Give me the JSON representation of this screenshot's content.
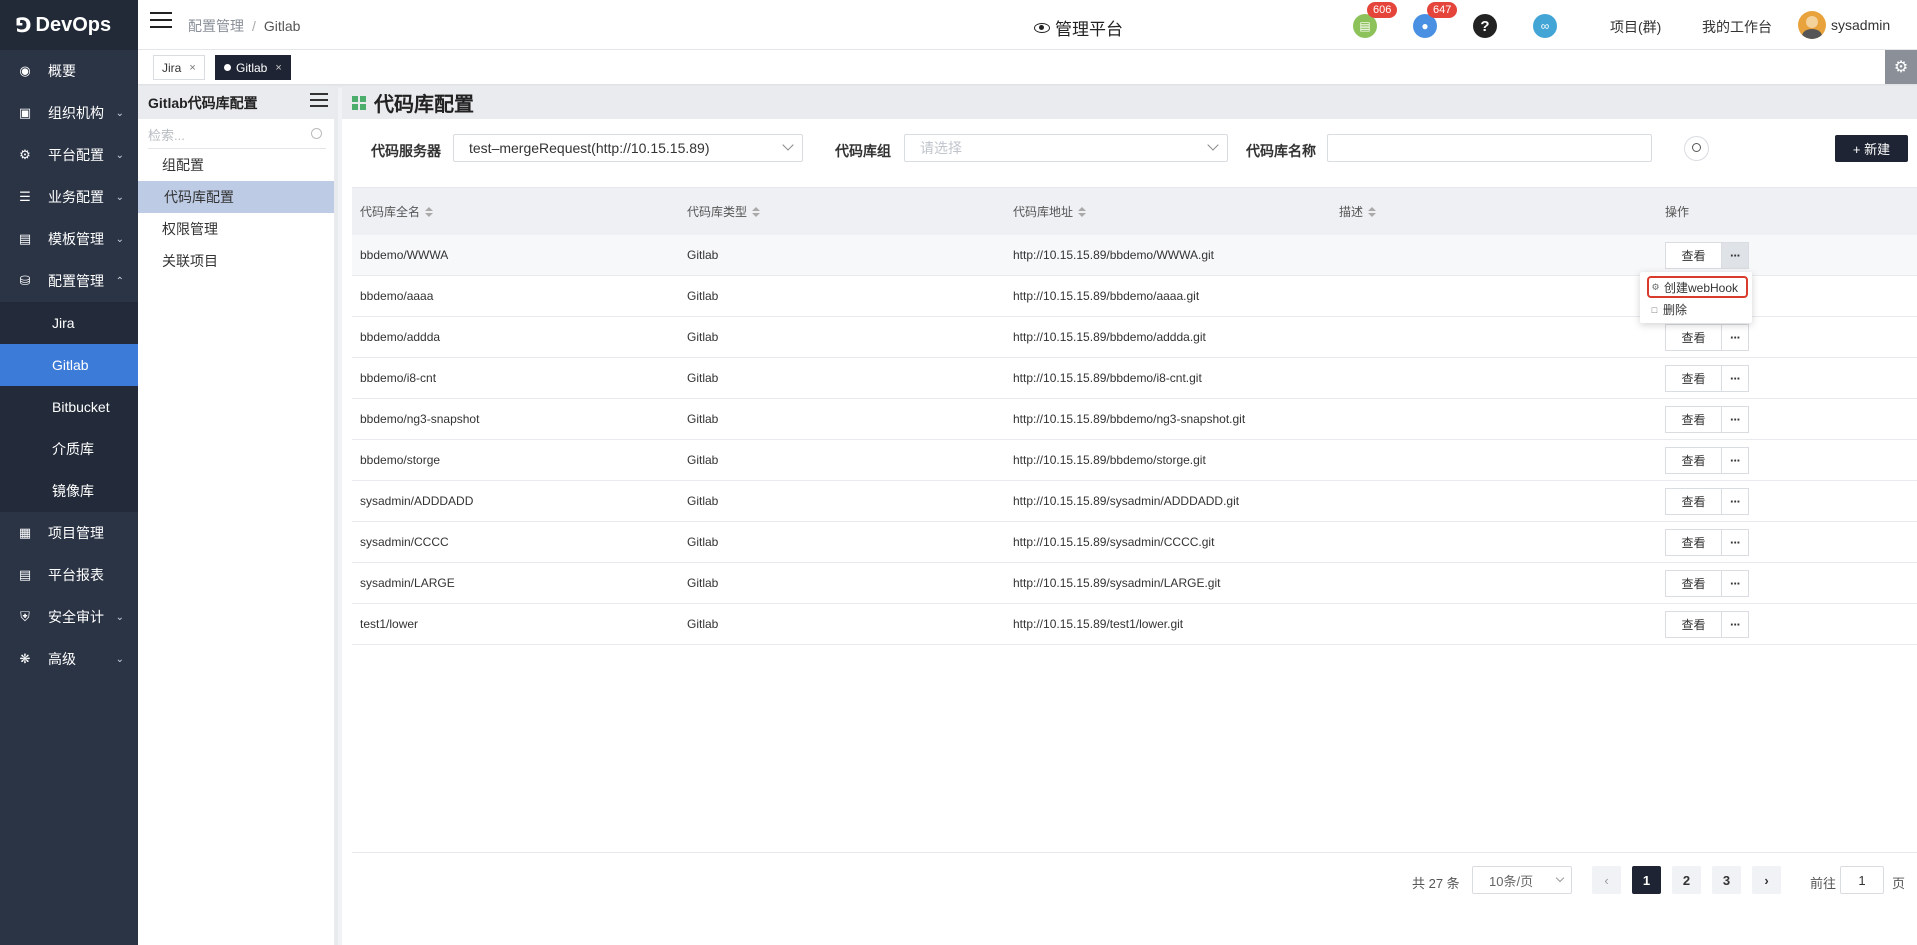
{
  "app": {
    "logo": "DevOps"
  },
  "nav": [
    {
      "label": "概要",
      "icon": "dashboard-icon"
    },
    {
      "label": "组织机构",
      "icon": "lock-icon"
    },
    {
      "label": "平台配置",
      "icon": "gear-icon"
    },
    {
      "label": "业务配置",
      "icon": "sliders-icon"
    },
    {
      "label": "模板管理",
      "icon": "template-icon"
    },
    {
      "label": "配置管理",
      "icon": "database-icon"
    },
    {
      "label": "Jira"
    },
    {
      "label": "Gitlab"
    },
    {
      "label": "Bitbucket"
    },
    {
      "label": "介质库"
    },
    {
      "label": "镜像库"
    },
    {
      "label": "项目管理",
      "icon": "grid-icon"
    },
    {
      "label": "平台报表",
      "icon": "monitor-icon"
    },
    {
      "label": "安全审计",
      "icon": "shield-icon"
    },
    {
      "label": "高级",
      "icon": "advanced-gear-icon"
    }
  ],
  "header": {
    "breadcrumb": [
      "配置管理",
      "/",
      "Gitlab"
    ],
    "title": "管理平台",
    "doc_badge": "606",
    "bell_badge": "647",
    "links": [
      "项目(群)",
      "我的工作台"
    ],
    "user": "sysadmin",
    "colors": {
      "doc": "#8dc25a",
      "bell": "#4a90e2",
      "help": "#222222",
      "link": "#43a5d5"
    }
  },
  "tabs": [
    {
      "label": "Jira"
    },
    {
      "label": "Gitlab"
    }
  ],
  "subside": {
    "title": "Gitlab代码库配置",
    "search_placeholder": "检索...",
    "items": [
      "组配置",
      "代码库配置",
      "权限管理",
      "关联项目"
    ]
  },
  "page": {
    "title": "代码库配置",
    "filters": {
      "server_label": "代码服务器",
      "server_value": "test–mergeRequest(http://10.15.15.89)",
      "group_label": "代码库组",
      "group_placeholder": "请选择",
      "name_label": "代码库名称"
    },
    "new_button": "+ 新建"
  },
  "table": {
    "headers": [
      "代码库全名",
      "代码库类型",
      "代码库地址",
      "描述",
      "操作"
    ],
    "view_label": "查看",
    "more_label": "···",
    "rows": [
      [
        "bbdemo/WWWA",
        "Gitlab",
        "http://10.15.15.89/bbdemo/WWWA.git",
        ""
      ],
      [
        "bbdemo/aaaa",
        "Gitlab",
        "http://10.15.15.89/bbdemo/aaaa.git",
        ""
      ],
      [
        "bbdemo/addda",
        "Gitlab",
        "http://10.15.15.89/bbdemo/addda.git",
        ""
      ],
      [
        "bbdemo/i8-cnt",
        "Gitlab",
        "http://10.15.15.89/bbdemo/i8-cnt.git",
        ""
      ],
      [
        "bbdemo/ng3-snapshot",
        "Gitlab",
        "http://10.15.15.89/bbdemo/ng3-snapshot.git",
        ""
      ],
      [
        "bbdemo/storge",
        "Gitlab",
        "http://10.15.15.89/bbdemo/storge.git",
        ""
      ],
      [
        "sysadmin/ADDDADD",
        "Gitlab",
        "http://10.15.15.89/sysadmin/ADDDADD.git",
        ""
      ],
      [
        "sysadmin/CCCC",
        "Gitlab",
        "http://10.15.15.89/sysadmin/CCCC.git",
        ""
      ],
      [
        "sysadmin/LARGE",
        "Gitlab",
        "http://10.15.15.89/sysadmin/LARGE.git",
        ""
      ],
      [
        "test1/lower",
        "Gitlab",
        "http://10.15.15.89/test1/lower.git",
        ""
      ]
    ]
  },
  "dropdown": {
    "items": [
      "创建webHook",
      "删除"
    ]
  },
  "pager": {
    "total": "共 27 条",
    "size": "10条/页",
    "pages": [
      "1",
      "2",
      "3"
    ],
    "goto_prefix": "前往",
    "goto_value": "1",
    "goto_suffix": "页"
  }
}
